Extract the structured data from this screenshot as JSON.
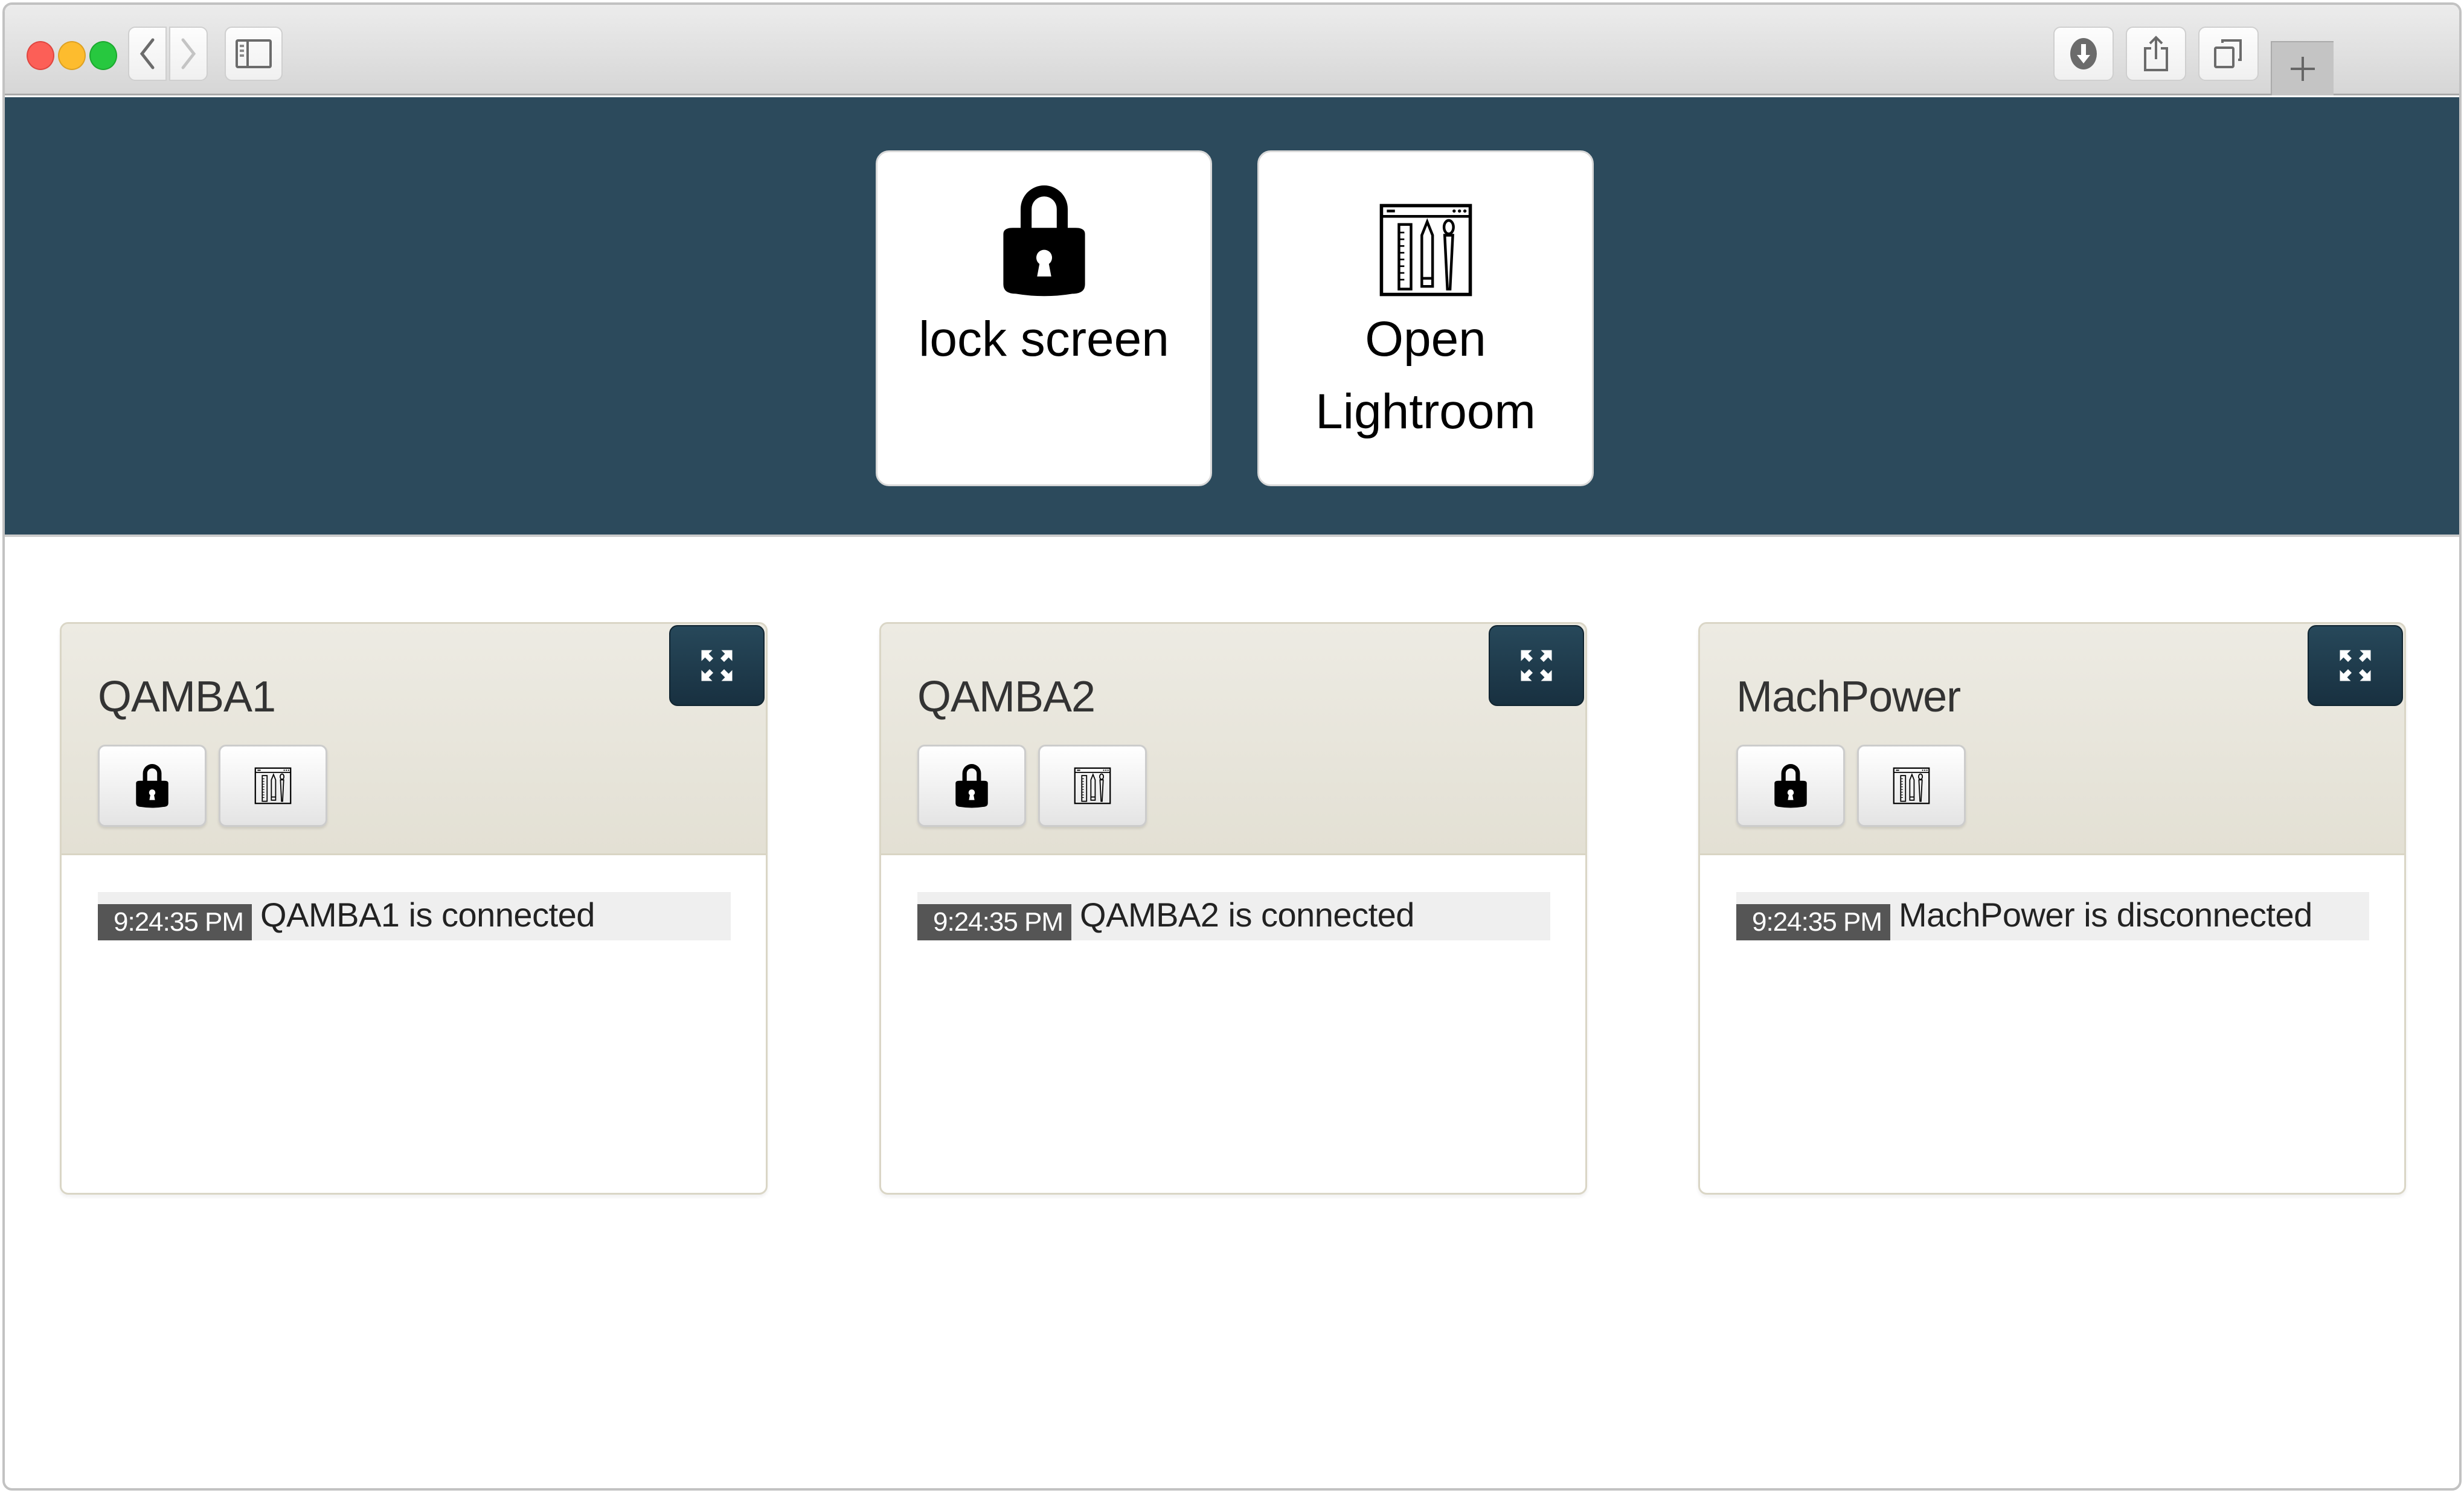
{
  "browser": {
    "toolbar": {
      "back_icon": "chevron-left-icon",
      "forward_icon": "chevron-right-icon",
      "sidebar_icon": "sidebar-icon",
      "download_icon": "download-icon",
      "share_icon": "share-icon",
      "tabs_icon": "tabs-overview-icon",
      "new_tab_icon": "plus-icon"
    }
  },
  "hero": {
    "background_color": "#2c4a5c",
    "actions": [
      {
        "label": "lock screen",
        "icon": "padlock-icon"
      },
      {
        "label": "Open Lightroom",
        "label_line1": "Open",
        "label_line2": "Lightroom",
        "icon": "design-tools-window-icon"
      }
    ]
  },
  "panels": [
    {
      "title": "QAMBA1",
      "expand_icon": "expand-icon",
      "buttons": [
        {
          "icon": "padlock-icon",
          "action": "lock screen"
        },
        {
          "icon": "design-tools-window-icon",
          "action": "Open Lightroom"
        }
      ],
      "log": [
        {
          "time": "9:24:35 PM",
          "message": "QAMBA1 is connected"
        }
      ]
    },
    {
      "title": "QAMBA2",
      "expand_icon": "expand-icon",
      "buttons": [
        {
          "icon": "padlock-icon",
          "action": "lock screen"
        },
        {
          "icon": "design-tools-window-icon",
          "action": "Open Lightroom"
        }
      ],
      "log": [
        {
          "time": "9:24:35 PM",
          "message": "QAMBA2 is connected"
        }
      ]
    },
    {
      "title": "MachPower",
      "expand_icon": "expand-icon",
      "buttons": [
        {
          "icon": "padlock-icon",
          "action": "lock screen"
        },
        {
          "icon": "design-tools-window-icon",
          "action": "Open Lightroom"
        }
      ],
      "log": [
        {
          "time": "9:24:35 PM",
          "message": "MachPower is disconnected"
        }
      ]
    }
  ]
}
